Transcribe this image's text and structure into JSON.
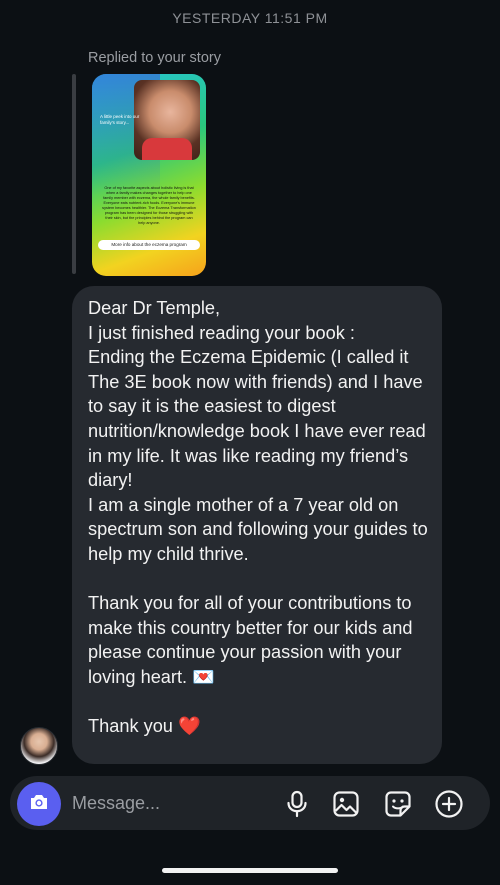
{
  "thread": {
    "timestamp": "YESTERDAY 11:51 PM",
    "reply_label": "Replied to your story"
  },
  "story": {
    "caption_top": "A little peek into our family's story...",
    "body_text": "One of my favorite aspects about holistic living is that when a family makes changes together to help one family member with eczema, the whole family benefits. Everyone eats nutrient-rich foods. Everyone's immune system becomes healthier. The Eczema Transformation program has been designed for those struggling with their skin, but the principles behind the program can help anyone. ",
    "pill_text": "More info about the eczema program"
  },
  "message": {
    "text": "Dear Dr Temple,\nI just finished reading your book :\nEnding the Eczema Epidemic (I called it The 3E book now with friends) and I have to say it is the easiest to digest nutrition/knowledge book I have ever read in my life. It was like reading my friend’s diary!\nI am a single mother of a 7 year old on spectrum son and following your guides to help my child thrive.\n\nThank you for all of your contributions to make this country better for our kids and please continue your passion with your loving heart. 💌\n\nThank you ❤️"
  },
  "composer": {
    "placeholder": "Message...",
    "icons": [
      "camera-icon",
      "microphone-icon",
      "gallery-icon",
      "sticker-icon",
      "plus-circle-icon"
    ],
    "camera_bg": "#5a5ff0"
  },
  "colors": {
    "background": "#0c1014",
    "bubble": "#262a30",
    "composer": "#1f2328"
  }
}
